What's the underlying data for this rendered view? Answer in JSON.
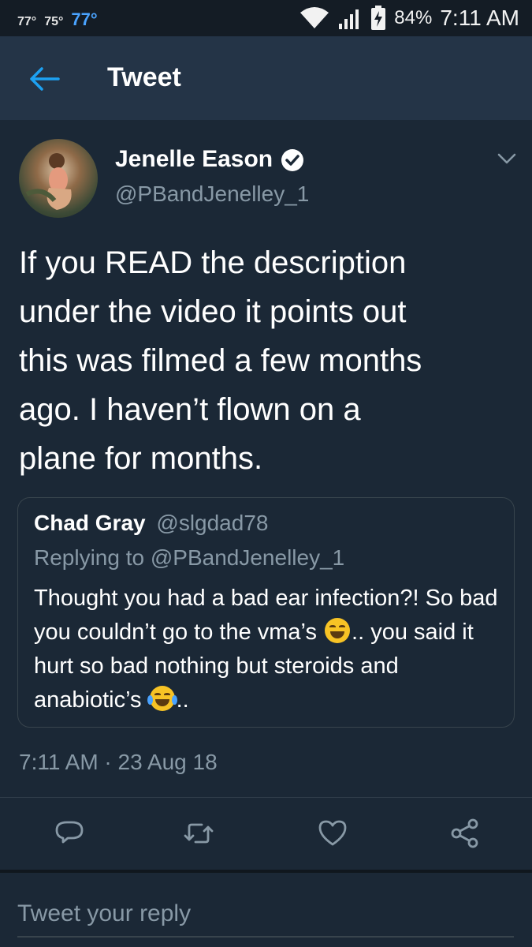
{
  "status_bar": {
    "temp_1": "77°",
    "temp_2": "75°",
    "temp_3": "77°",
    "battery": "84%",
    "time": "7:11 AM"
  },
  "app_bar": {
    "title": "Tweet",
    "back_icon": "arrow-left-icon"
  },
  "tweet": {
    "author_name": "Jenelle Eason",
    "author_handle": "@PBandJenelley_1",
    "verified": true,
    "text": "If you READ the description\nunder the video it points out\nthis was filmed a few months\nago. I haven’t flown on a\nplane for months.",
    "timestamp": "7:11 AM · 23 Aug 18"
  },
  "quoted_tweet": {
    "author_name": "Chad Gray",
    "author_handle": "@slgdad78",
    "replying_to": "Replying to @PBandJenelley_1",
    "text_part_1": "Thought you had a bad ear infection?! So bad you couldn’t go to the vma’s",
    "text_part_2": ".. you said it hurt so bad nothing but steroids and anabiotic’s",
    "text_part_3": ".."
  },
  "actions": [
    "reply-icon",
    "retweet-icon",
    "like-icon",
    "share-icon"
  ],
  "reply": {
    "placeholder": "Tweet your reply"
  },
  "colors": {
    "background": "#1b2836",
    "app_bar": "#243447",
    "accent": "#1da1f2",
    "muted_text": "#8899a6"
  }
}
